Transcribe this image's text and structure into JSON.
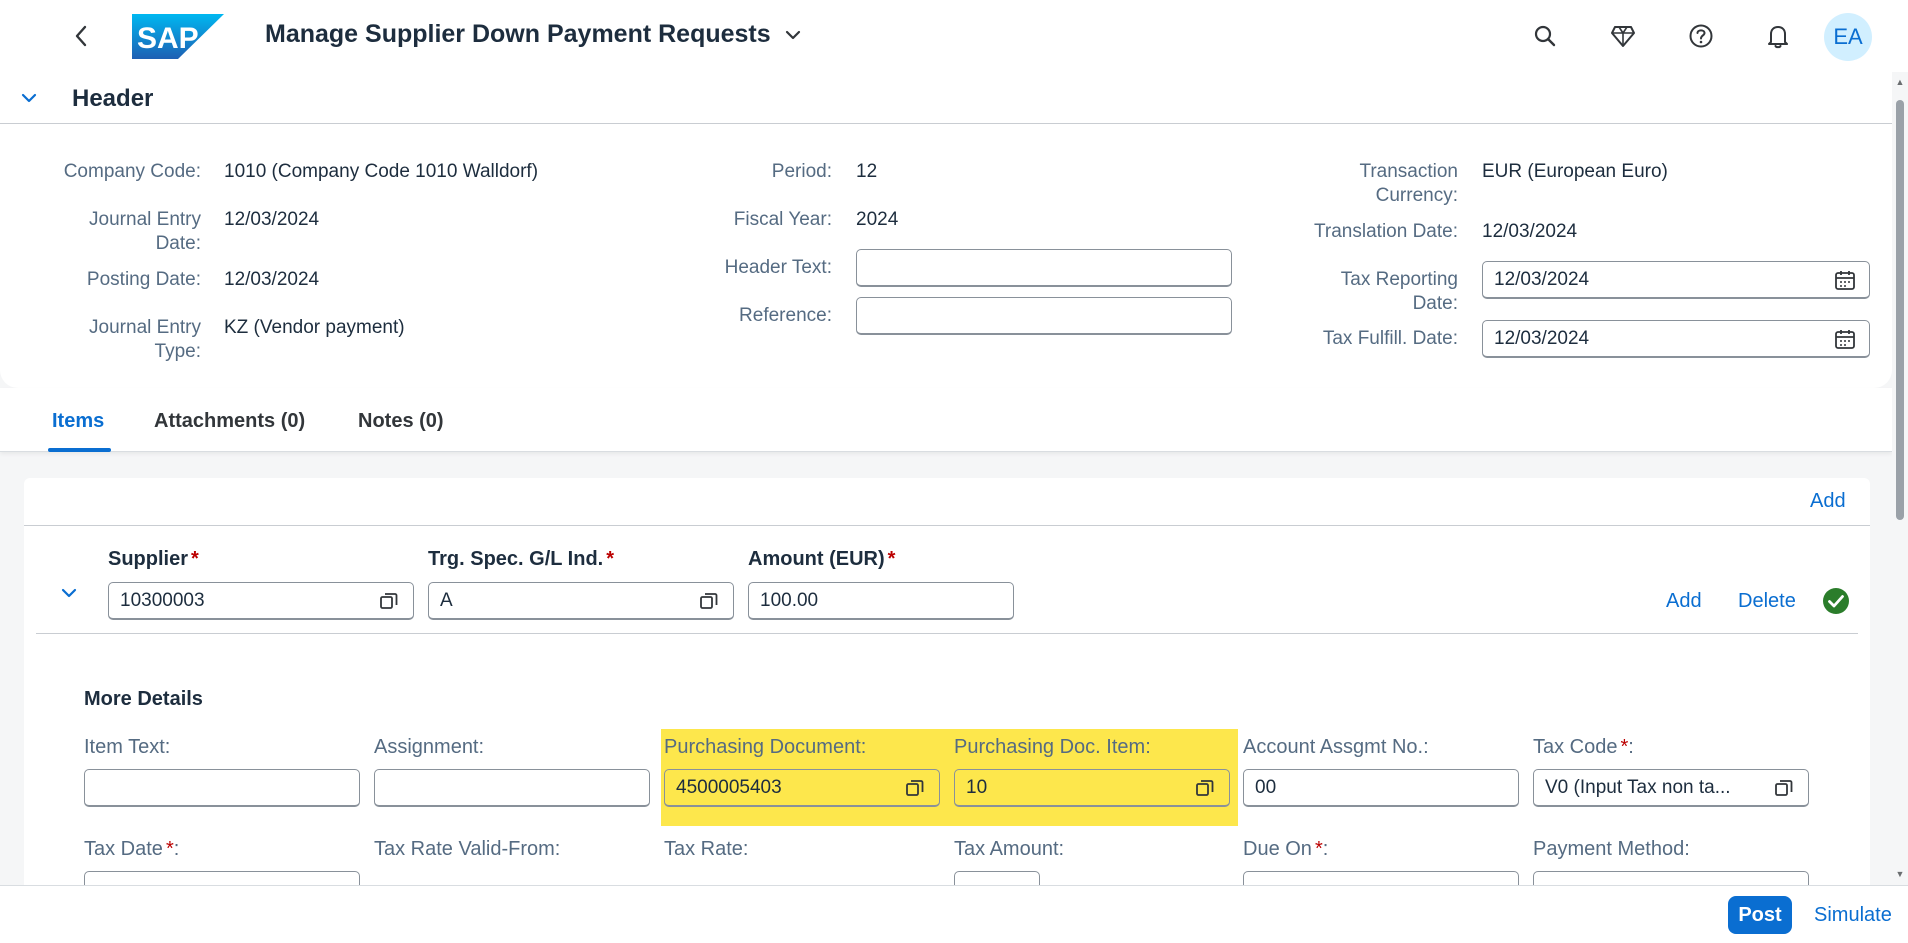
{
  "shell": {
    "logo_text": "SAP",
    "app_title": "Manage Supplier Down Payment Requests",
    "avatar_initials": "EA",
    "colors": {
      "accent": "#0a6ed1",
      "required": "#bb0000",
      "success": "#2b7d2b",
      "highlight": "#fde74c"
    }
  },
  "header": {
    "title": "Header",
    "fields": {
      "company_code": {
        "label": "Company Code:",
        "value": "1010 (Company Code 1010 Walldorf)"
      },
      "journal_entry_date": {
        "label_line1": "Journal Entry",
        "label_line2": "Date:",
        "value": "12/03/2024"
      },
      "posting_date": {
        "label": "Posting Date:",
        "value": "12/03/2024"
      },
      "journal_entry_type": {
        "label_line1": "Journal Entry",
        "label_line2": "Type:",
        "value": "KZ (Vendor payment)"
      },
      "period": {
        "label": "Period:",
        "value": "12"
      },
      "fiscal_year": {
        "label": "Fiscal Year:",
        "value": "2024"
      },
      "header_text": {
        "label": "Header Text:",
        "value": ""
      },
      "reference": {
        "label": "Reference:",
        "value": ""
      },
      "transaction_currency": {
        "label_line1": "Transaction",
        "label_line2": "Currency:",
        "value": "EUR (European Euro)"
      },
      "translation_date": {
        "label": "Translation Date:",
        "value": "12/03/2024"
      },
      "tax_reporting_date": {
        "label_line1": "Tax Reporting",
        "label_line2": "Date:",
        "value": "12/03/2024"
      },
      "tax_fulfill_date": {
        "label": "Tax Fulfill. Date:",
        "value": "12/03/2024"
      }
    }
  },
  "tabs": [
    {
      "label": "Items",
      "active": true
    },
    {
      "label": "Attachments (0)",
      "active": false
    },
    {
      "label": "Notes (0)",
      "active": false
    }
  ],
  "items": {
    "toolbar_add": "Add",
    "columns": {
      "supplier": "Supplier",
      "trg_spec": "Trg. Spec. G/L Ind.",
      "amount": "Amount (EUR)",
      "required_mark": "*"
    },
    "row": {
      "supplier": "10300003",
      "trg_spec": "A",
      "amount": "100.00",
      "add_label": "Add",
      "delete_label": "Delete",
      "status_icon": "success-check-icon"
    },
    "more_details": {
      "title": "More Details",
      "item_text": {
        "label": "Item Text:",
        "value": ""
      },
      "assignment": {
        "label": "Assignment:",
        "value": ""
      },
      "purchasing_document": {
        "label": "Purchasing Document:",
        "value": "4500005403"
      },
      "purchasing_doc_item": {
        "label": "Purchasing Doc. Item:",
        "value": "10"
      },
      "account_assgmt_no": {
        "label": "Account Assgmt No.:",
        "value": "00"
      },
      "tax_code": {
        "label": "Tax Code",
        "label_suffix": ":",
        "value": "V0 (Input Tax non ta..."
      },
      "tax_date": {
        "label": "Tax Date",
        "label_suffix": ":"
      },
      "tax_rate_valid_from": {
        "label": "Tax Rate Valid-From:"
      },
      "tax_rate": {
        "label": "Tax Rate:"
      },
      "tax_amount": {
        "label": "Tax Amount:"
      },
      "due_on": {
        "label": "Due On",
        "label_suffix": ":"
      },
      "payment_method": {
        "label": "Payment Method:"
      }
    }
  },
  "footer": {
    "post_label": "Post",
    "simulate_label": "Simulate"
  }
}
